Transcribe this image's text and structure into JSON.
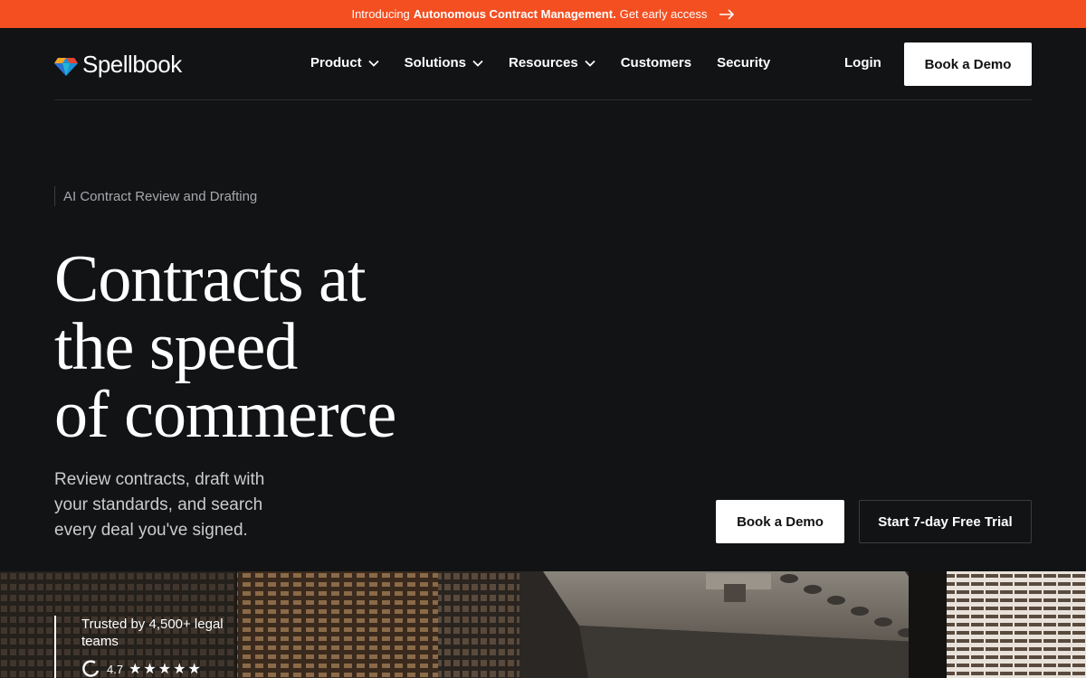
{
  "announcement": {
    "prefix": "Introducing",
    "highlight": "Autonomous Contract Management.",
    "cta": "Get early access"
  },
  "brand": {
    "name": "Spellbook",
    "accent": "#f34f21"
  },
  "nav": {
    "items": [
      {
        "label": "Product",
        "dropdown": true
      },
      {
        "label": "Solutions",
        "dropdown": true
      },
      {
        "label": "Resources",
        "dropdown": true
      },
      {
        "label": "Customers",
        "dropdown": false
      },
      {
        "label": "Security",
        "dropdown": false
      }
    ],
    "login": "Login",
    "demo": "Book a Demo"
  },
  "hero": {
    "eyebrow": "AI Contract Review and Drafting",
    "headline": [
      "Contracts at",
      "the speed",
      "of commerce"
    ],
    "subtext": "Review contracts, draft with your standards, and search every deal you've signed.",
    "primary_cta": "Book a Demo",
    "secondary_cta": "Start 7-day Free Trial"
  },
  "trust": {
    "text": "Trusted by 4,500+ legal teams",
    "rating": "4.7",
    "stars": 5
  }
}
